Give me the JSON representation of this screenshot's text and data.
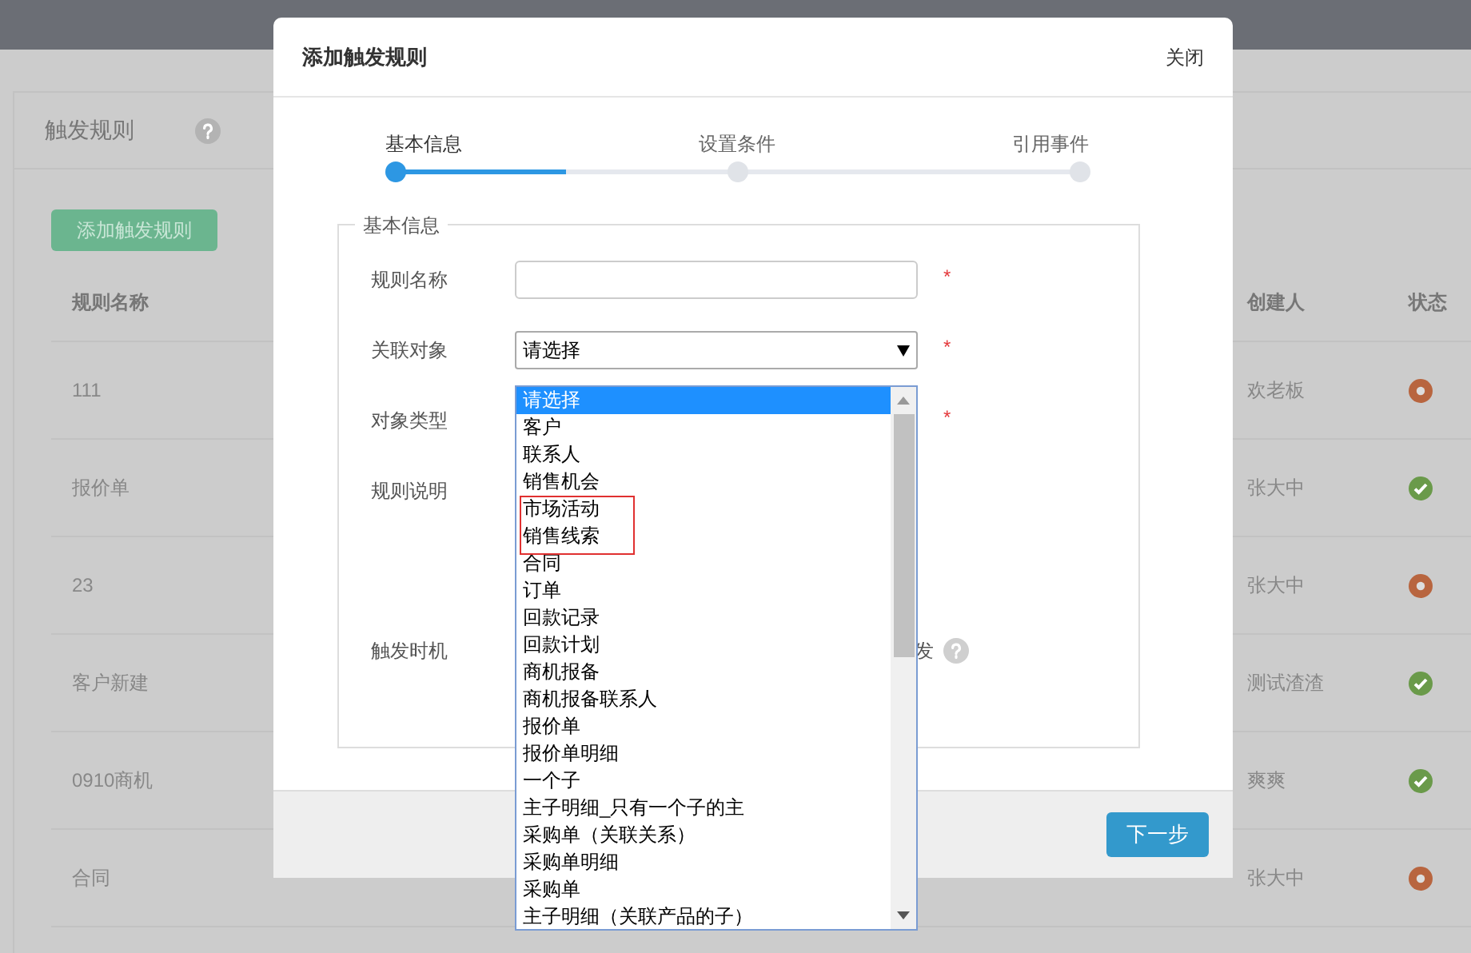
{
  "page": {
    "title": "触发规则",
    "add_button": "添加触发规则",
    "columns": [
      "规则名称",
      "创建人",
      "状态"
    ],
    "rows": [
      {
        "name": "111",
        "creator": "欢老板",
        "enabled": false
      },
      {
        "name": "报价单",
        "creator": "张大中",
        "enabled": true
      },
      {
        "name": "23",
        "creator": "张大中",
        "enabled": false
      },
      {
        "name": "客户新建",
        "creator": "测试渣渣",
        "enabled": true
      },
      {
        "name": "0910商机",
        "creator": "爽爽",
        "enabled": true
      },
      {
        "name": "合同",
        "creator": "张大中",
        "enabled": false
      }
    ]
  },
  "dialog": {
    "title": "添加触发规则",
    "close": "关闭",
    "steps": [
      {
        "label": "基本信息",
        "selected": true
      },
      {
        "label": "设置条件",
        "selected": false
      },
      {
        "label": "引用事件",
        "selected": false
      }
    ],
    "progress": {
      "level": 0.25
    },
    "section": "基本信息",
    "fields": [
      {
        "label": "规则名称",
        "kind": "text",
        "required_mark": "*"
      },
      {
        "label": "关联对象",
        "kind": "select",
        "value": "请选择",
        "required_mark": "*"
      },
      {
        "label": "对象类型",
        "kind": "blank",
        "required_mark": "*"
      },
      {
        "label": "规则说明",
        "kind": "blank"
      },
      {
        "label": "触发时机",
        "kind": "trigger",
        "fragment": "发"
      }
    ],
    "options": [
      {
        "label": "请选择",
        "selected": true,
        "outlined": false
      },
      {
        "label": "客户",
        "selected": false,
        "outlined": false
      },
      {
        "label": "联系人",
        "selected": false,
        "outlined": false
      },
      {
        "label": "销售机会",
        "selected": false,
        "outlined": false
      },
      {
        "label": "市场活动",
        "selected": false,
        "outlined": true
      },
      {
        "label": "销售线索",
        "selected": false,
        "outlined": true
      },
      {
        "label": "合同",
        "selected": false,
        "outlined": false
      },
      {
        "label": "订单",
        "selected": false,
        "outlined": false
      },
      {
        "label": "回款记录",
        "selected": false,
        "outlined": false
      },
      {
        "label": "回款计划",
        "selected": false,
        "outlined": false
      },
      {
        "label": "商机报备",
        "selected": false,
        "outlined": false
      },
      {
        "label": "商机报备联系人",
        "selected": false,
        "outlined": false
      },
      {
        "label": "报价单",
        "selected": false,
        "outlined": false
      },
      {
        "label": "报价单明细",
        "selected": false,
        "outlined": false
      },
      {
        "label": "一个子",
        "selected": false,
        "outlined": false
      },
      {
        "label": "主子明细_只有一个子的主",
        "selected": false,
        "outlined": false
      },
      {
        "label": "采购单（关联关系）",
        "selected": false,
        "outlined": false
      },
      {
        "label": "采购单明细",
        "selected": false,
        "outlined": false
      },
      {
        "label": "采购单",
        "selected": false,
        "outlined": false
      },
      {
        "label": "主子明细（关联产品的子）",
        "selected": false,
        "outlined": false
      }
    ],
    "next_button": "下一步"
  }
}
